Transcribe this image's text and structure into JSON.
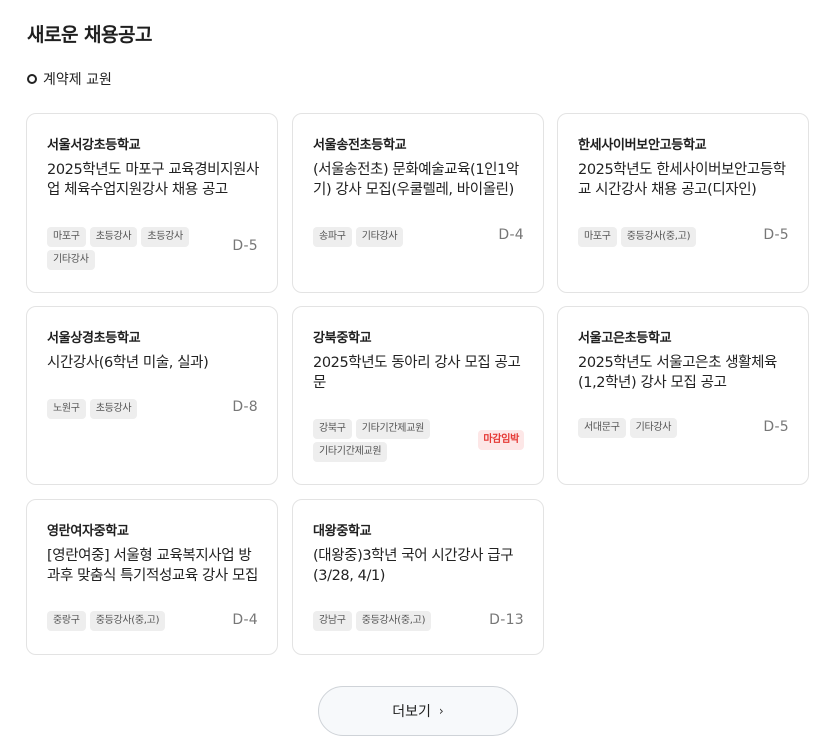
{
  "page": {
    "title": "새로운 채용공고",
    "section": "계약제 교원",
    "more_label": "더보기",
    "chevron_glyph": "›"
  },
  "jobs": [
    {
      "school": "서울서강초등학교",
      "title": "2025학년도 마포구 교육경비지원사업 체육수업지원강사 채용 공고",
      "tags": [
        "마포구",
        "초등강사",
        "초등강사",
        "기타강사"
      ],
      "dday": "D-5",
      "badge": ""
    },
    {
      "school": "서울송전초등학교",
      "title": "(서울송전초) 문화예술교육(1인1악기) 강사 모집(우쿨렐레, 바이올린)",
      "tags": [
        "송파구",
        "기타강사"
      ],
      "dday": "D-4",
      "badge": ""
    },
    {
      "school": "한세사이버보안고등학교",
      "title": "2025학년도 한세사이버보안고등학교 시간강사 채용 공고(디자인)",
      "tags": [
        "마포구",
        "중등강사(중,고)"
      ],
      "dday": "D-5",
      "badge": ""
    },
    {
      "school": "서울상경초등학교",
      "title": "시간강사(6학년 미술, 실과)",
      "tags": [
        "노원구",
        "초등강사"
      ],
      "dday": "D-8",
      "badge": ""
    },
    {
      "school": "강북중학교",
      "title": "2025학년도 동아리 강사 모집 공고문",
      "tags": [
        "강북구",
        "기타기간제교원",
        "기타기간제교원"
      ],
      "dday": "",
      "badge": "마감임박"
    },
    {
      "school": "서울고은초등학교",
      "title": "2025학년도 서울고은초 생활체육(1,2학년) 강사 모집 공고",
      "tags": [
        "서대문구",
        "기타강사"
      ],
      "dday": "D-5",
      "badge": ""
    },
    {
      "school": "영란여자중학교",
      "title": "[영란여중] 서울형 교육복지사업 방과후 맞춤식 특기적성교육 강사 모집",
      "tags": [
        "중랑구",
        "중등강사(중,고)"
      ],
      "dday": "D-4",
      "badge": ""
    },
    {
      "school": "대왕중학교",
      "title": "(대왕중)3학년 국어 시간강사 급구(3/28, 4/1)",
      "tags": [
        "강남구",
        "중등강사(중,고)"
      ],
      "dday": "D-13",
      "badge": ""
    }
  ]
}
